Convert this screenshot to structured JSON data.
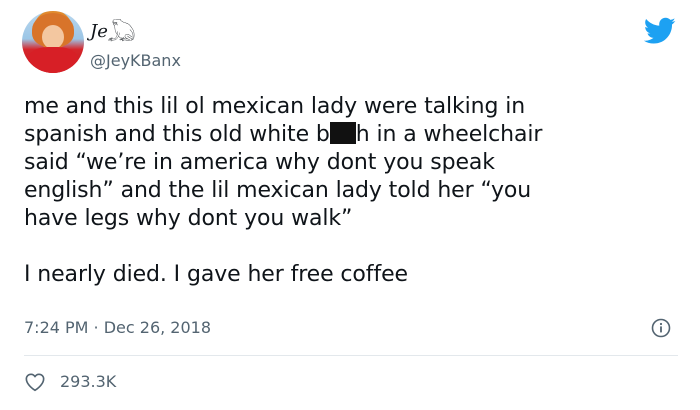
{
  "user": {
    "display_name": "Je𓆏",
    "handle": "@JeyKBanx"
  },
  "tweet": {
    "line1": "me and this lil ol mexican lady were talking in",
    "line2_a": "spanish and this old white b",
    "line2_b": "h in a wheelchair",
    "line3": "said “we’re in america why dont you speak",
    "line4": "english” and the lil mexican lady told her “you",
    "line5": "have legs why dont you walk”",
    "line6": "I nearly died. I gave her free coffee"
  },
  "meta": {
    "timestamp": "7:24 PM · Dec 26, 2018"
  },
  "stats": {
    "likes": "293.3K"
  },
  "icons": {
    "brand": "twitter-bird-icon",
    "info": "info-icon",
    "like": "heart-icon"
  },
  "colors": {
    "twitter_blue": "#1da1f2",
    "text": "#0f1419",
    "muted": "#536471",
    "divider": "#e3e8ec"
  }
}
